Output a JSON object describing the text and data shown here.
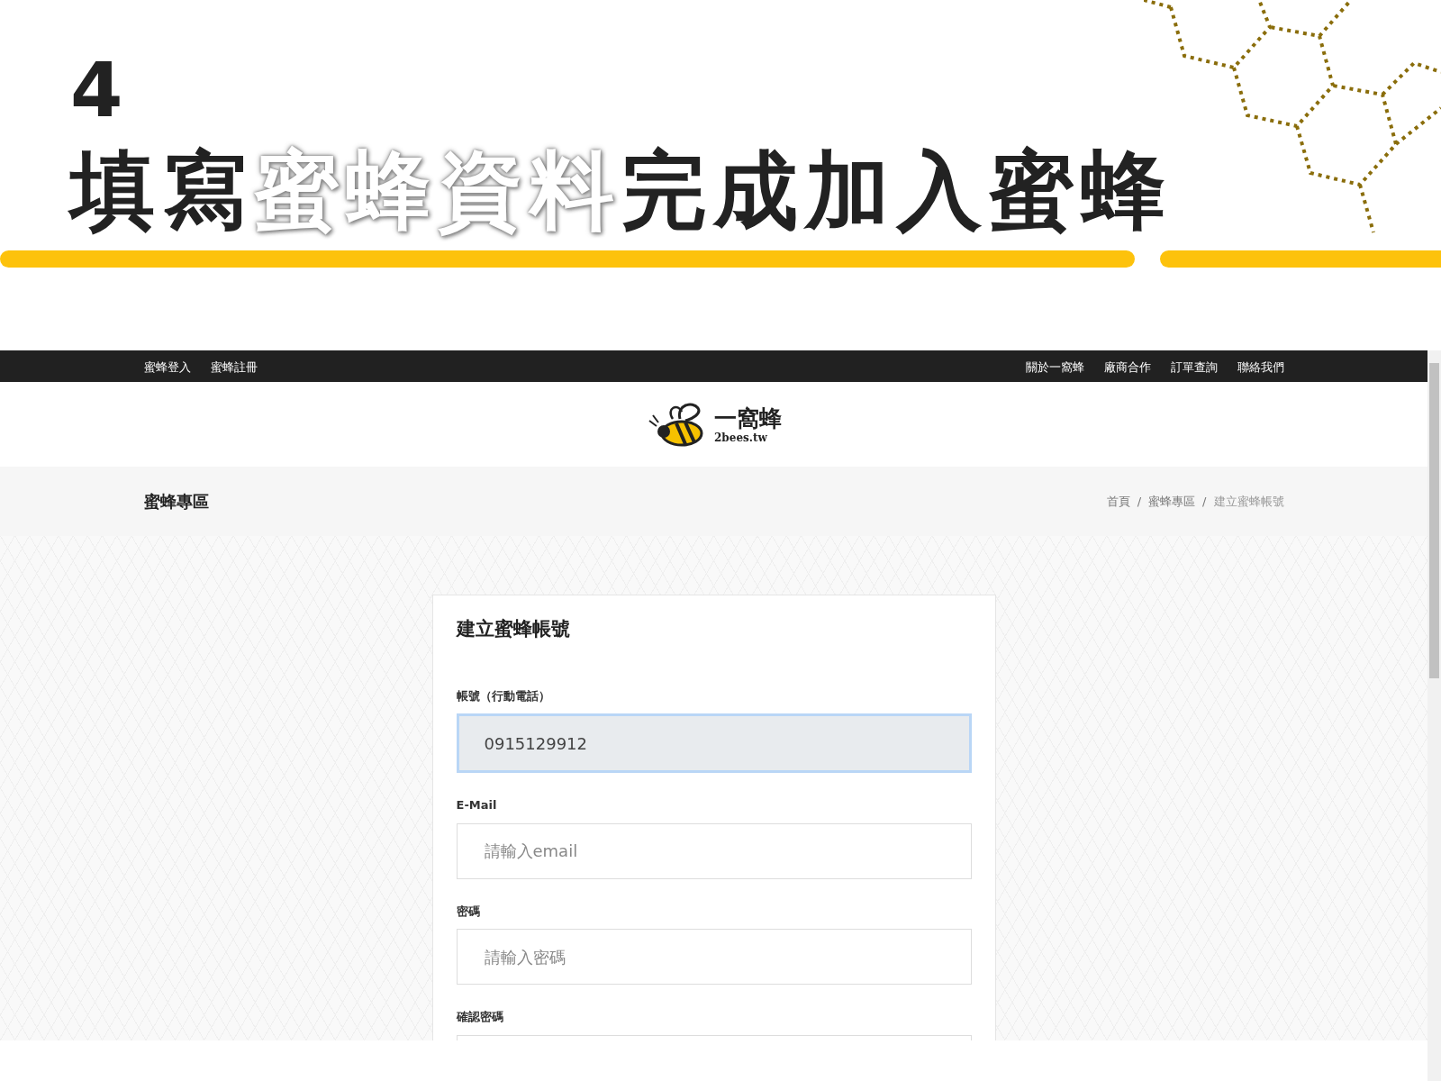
{
  "step": "4",
  "title": [
    {
      "text": "填寫",
      "highlight": false
    },
    {
      "text": "蜜蜂資料",
      "highlight": true
    },
    {
      "text": "完成加入蜜蜂",
      "highlight": false
    }
  ],
  "top_nav": {
    "left": [
      "蜜蜂登入",
      "蜜蜂註冊"
    ],
    "right": [
      "關於一窩蜂",
      "廠商合作",
      "訂單查詢",
      "聯絡我們"
    ]
  },
  "logo": {
    "name": "一窩蜂",
    "domain": "2bees.tw"
  },
  "page_header": {
    "title": "蜜蜂專區",
    "separator": "/",
    "breadcrumb": [
      {
        "label": "首頁",
        "current": false
      },
      {
        "label": "蜜蜂專區",
        "current": false
      },
      {
        "label": "建立蜜蜂帳號",
        "current": true
      }
    ]
  },
  "form": {
    "title": "建立蜜蜂帳號",
    "fields": [
      {
        "label": "帳號（行動電話）",
        "value": "0915129912",
        "focused": true
      },
      {
        "label": "E-Mail",
        "placeholder": "請輸入email",
        "focused": false
      },
      {
        "label": "密碼",
        "placeholder": "請輸入密碼",
        "focused": false
      },
      {
        "label": "確認密碼"
      }
    ]
  }
}
